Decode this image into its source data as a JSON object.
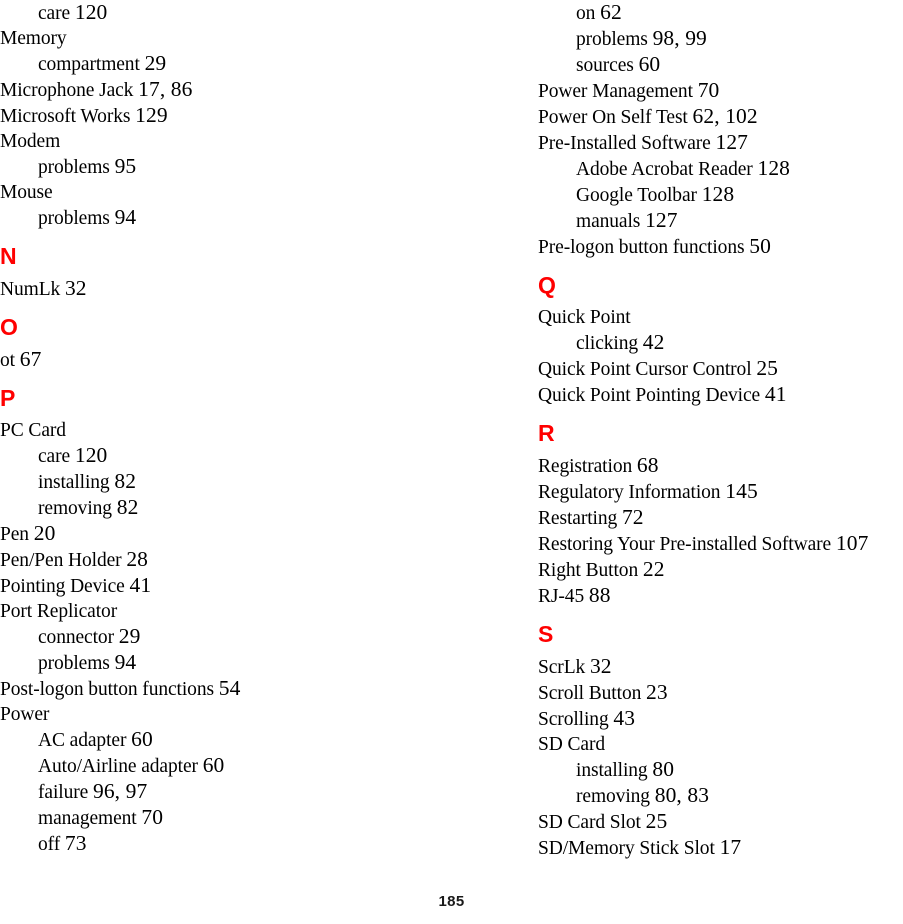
{
  "document": {
    "type": "index",
    "page_number": "185",
    "accent_color": "#ff0000",
    "text_color": "#000000",
    "background_color": "#ffffff"
  },
  "columns": [
    {
      "name": "left-column",
      "blocks": [
        {
          "kind": "entry",
          "level": 2,
          "term": "care",
          "pages": "120"
        },
        {
          "kind": "entry",
          "level": 1,
          "term": "Memory",
          "pages": ""
        },
        {
          "kind": "entry",
          "level": 2,
          "term": "compartment",
          "pages": "29"
        },
        {
          "kind": "entry",
          "level": 1,
          "term": "Microphone Jack",
          "pages": "17, 86"
        },
        {
          "kind": "entry",
          "level": 1,
          "term": "Microsoft Works",
          "pages": "129"
        },
        {
          "kind": "entry",
          "level": 1,
          "term": "Modem",
          "pages": ""
        },
        {
          "kind": "entry",
          "level": 2,
          "term": "problems",
          "pages": "95"
        },
        {
          "kind": "entry",
          "level": 1,
          "term": "Mouse",
          "pages": ""
        },
        {
          "kind": "entry",
          "level": 2,
          "term": "problems",
          "pages": "94"
        },
        {
          "kind": "heading",
          "letter": "N"
        },
        {
          "kind": "entry",
          "level": 1,
          "term": "NumLk",
          "pages": "32"
        },
        {
          "kind": "heading",
          "letter": "O"
        },
        {
          "kind": "entry",
          "level": 1,
          "term": "ot",
          "pages": "67"
        },
        {
          "kind": "heading",
          "letter": "P"
        },
        {
          "kind": "entry",
          "level": 1,
          "term": "PC Card",
          "pages": ""
        },
        {
          "kind": "entry",
          "level": 2,
          "term": "care",
          "pages": "120"
        },
        {
          "kind": "entry",
          "level": 2,
          "term": "installing",
          "pages": "82"
        },
        {
          "kind": "entry",
          "level": 2,
          "term": "removing",
          "pages": "82"
        },
        {
          "kind": "entry",
          "level": 1,
          "term": "Pen",
          "pages": "20"
        },
        {
          "kind": "entry",
          "level": 1,
          "term": "Pen/Pen Holder",
          "pages": "28"
        },
        {
          "kind": "entry",
          "level": 1,
          "term": "Pointing Device",
          "pages": "41"
        },
        {
          "kind": "entry",
          "level": 1,
          "term": "Port Replicator",
          "pages": ""
        },
        {
          "kind": "entry",
          "level": 2,
          "term": "connector",
          "pages": "29"
        },
        {
          "kind": "entry",
          "level": 2,
          "term": "problems",
          "pages": "94"
        },
        {
          "kind": "entry",
          "level": 1,
          "term": "Post-logon button functions",
          "pages": "54"
        },
        {
          "kind": "entry",
          "level": 1,
          "term": "Power",
          "pages": ""
        },
        {
          "kind": "entry",
          "level": 2,
          "term": "AC adapter",
          "pages": "60"
        },
        {
          "kind": "entry",
          "level": 2,
          "term": "Auto/Airline adapter",
          "pages": "60"
        },
        {
          "kind": "entry",
          "level": 2,
          "term": "failure",
          "pages": "96, 97"
        },
        {
          "kind": "entry",
          "level": 2,
          "term": "management",
          "pages": "70"
        },
        {
          "kind": "entry",
          "level": 2,
          "term": "off",
          "pages": "73"
        }
      ]
    },
    {
      "name": "right-column",
      "blocks": [
        {
          "kind": "entry",
          "level": 2,
          "term": "on",
          "pages": "62"
        },
        {
          "kind": "entry",
          "level": 2,
          "term": "problems",
          "pages": "98, 99"
        },
        {
          "kind": "entry",
          "level": 2,
          "term": "sources",
          "pages": "60"
        },
        {
          "kind": "entry",
          "level": 1,
          "term": "Power Management",
          "pages": "70"
        },
        {
          "kind": "entry",
          "level": 1,
          "term": "Power On Self Test",
          "pages": "62, 102"
        },
        {
          "kind": "entry",
          "level": 1,
          "term": "Pre-Installed Software",
          "pages": "127"
        },
        {
          "kind": "entry",
          "level": 2,
          "term": "Adobe Acrobat Reader",
          "pages": "128"
        },
        {
          "kind": "entry",
          "level": 2,
          "term": "Google Toolbar",
          "pages": "128"
        },
        {
          "kind": "entry",
          "level": 2,
          "term": "manuals",
          "pages": "127"
        },
        {
          "kind": "entry",
          "level": 1,
          "term": "Pre-logon button functions",
          "pages": "50"
        },
        {
          "kind": "heading",
          "letter": "Q"
        },
        {
          "kind": "entry",
          "level": 1,
          "term": "Quick Point",
          "pages": ""
        },
        {
          "kind": "entry",
          "level": 2,
          "term": "clicking",
          "pages": "42"
        },
        {
          "kind": "entry",
          "level": 1,
          "term": "Quick Point Cursor Control",
          "pages": "25"
        },
        {
          "kind": "entry",
          "level": 1,
          "term": "Quick Point Pointing Device",
          "pages": "41"
        },
        {
          "kind": "heading",
          "letter": "R"
        },
        {
          "kind": "entry",
          "level": 1,
          "term": "Registration",
          "pages": "68"
        },
        {
          "kind": "entry",
          "level": 1,
          "term": "Regulatory Information",
          "pages": "145"
        },
        {
          "kind": "entry",
          "level": 1,
          "term": "Restarting",
          "pages": "72"
        },
        {
          "kind": "entry",
          "level": 1,
          "term": "Restoring Your Pre-installed Software",
          "pages": "107"
        },
        {
          "kind": "entry",
          "level": 1,
          "term": "Right Button",
          "pages": "22"
        },
        {
          "kind": "entry",
          "level": 1,
          "term": "RJ-45",
          "pages": "88"
        },
        {
          "kind": "heading",
          "letter": "S"
        },
        {
          "kind": "entry",
          "level": 1,
          "term": "ScrLk",
          "pages": "32"
        },
        {
          "kind": "entry",
          "level": 1,
          "term": "Scroll Button",
          "pages": "23"
        },
        {
          "kind": "entry",
          "level": 1,
          "term": "Scrolling",
          "pages": "43"
        },
        {
          "kind": "entry",
          "level": 1,
          "term": "SD Card",
          "pages": ""
        },
        {
          "kind": "entry",
          "level": 2,
          "term": "installing",
          "pages": "80"
        },
        {
          "kind": "entry",
          "level": 2,
          "term": "removing",
          "pages": "80, 83"
        },
        {
          "kind": "entry",
          "level": 1,
          "term": "SD Card Slot",
          "pages": "25"
        },
        {
          "kind": "entry",
          "level": 1,
          "term": "SD/Memory Stick Slot",
          "pages": "17"
        }
      ]
    }
  ]
}
